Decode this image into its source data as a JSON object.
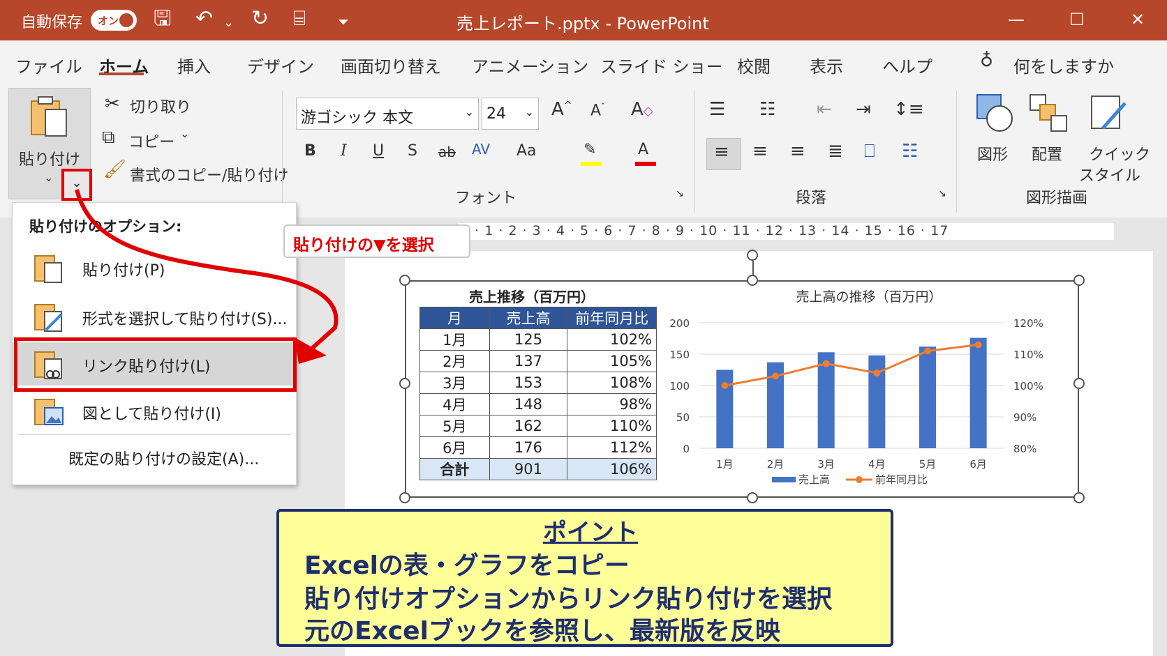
{
  "titlebar": {
    "autosave_label": "自動保存",
    "toggle_label": "オン",
    "title": "売上レポート.pptx  -  PowerPoint",
    "minimize": "—",
    "maximize": "☐",
    "close": "✕"
  },
  "tabs": [
    "ファイル",
    "ホーム",
    "挿入",
    "デザイン",
    "画面切り替え",
    "アニメーション",
    "スライド ショー",
    "校閲",
    "表示",
    "ヘルプ"
  ],
  "active_tab": "ホーム",
  "tell_me": "何をしますか",
  "ribbon": {
    "paste_label": "貼り付け",
    "cut_label": "切り取り",
    "copy_label": "コピー",
    "format_painter_label": "書式のコピー/貼り付け",
    "font_name": "游ゴシック 本文",
    "font_size": "24",
    "font_group_label": "フォント",
    "paragraph_group_label": "段落",
    "drawing_group_label": "図形描画",
    "shapes_label": "図形",
    "arrange_label": "配置",
    "quick_style_label_1": "クイック",
    "quick_style_label_2": "スタイル"
  },
  "ruler_text": "3 · 1 · 2 · 3 · 4 · 5 · 6 · 7 · 8 · 9 · 10 · 11 · 12 · 13 · 14 · 15 · 16 · 17",
  "paste_options": {
    "header": "貼り付けのオプション:",
    "items": [
      {
        "label": "貼り付け(P)"
      },
      {
        "label": "形式を選択して貼り付け(S)..."
      },
      {
        "label": "リンク貼り付け(L)"
      },
      {
        "label": "図として貼り付け(I)"
      }
    ],
    "default_settings": "既定の貼り付けの設定(A)..."
  },
  "annotation_label": "貼り付けの▼を選択",
  "table": {
    "title": "売上推移（百万円）",
    "headers": [
      "月",
      "売上高",
      "前年同月比"
    ],
    "rows": [
      [
        "1月",
        "125",
        "102%"
      ],
      [
        "2月",
        "137",
        "105%"
      ],
      [
        "3月",
        "153",
        "108%"
      ],
      [
        "4月",
        "148",
        "98%"
      ],
      [
        "5月",
        "162",
        "110%"
      ],
      [
        "6月",
        "176",
        "112%"
      ]
    ],
    "total": [
      "合計",
      "901",
      "106%"
    ]
  },
  "chart_data": {
    "type": "bar",
    "title": "売上高の推移（百万円）",
    "categories": [
      "1月",
      "2月",
      "3月",
      "4月",
      "5月",
      "6月"
    ],
    "series": [
      {
        "name": "売上高",
        "type": "bar",
        "axis": "left",
        "values": [
          125,
          137,
          153,
          148,
          162,
          176
        ],
        "color": "#4472c4"
      },
      {
        "name": "前年同月比",
        "type": "line",
        "axis": "right",
        "values": [
          100,
          103,
          107,
          104,
          111,
          113
        ],
        "color": "#ed7d31"
      }
    ],
    "ylim": [
      0,
      200
    ],
    "y_ticks": [
      "0",
      "50",
      "100",
      "150",
      "200"
    ],
    "y2lim": [
      80,
      120
    ],
    "y2_ticks": [
      "80%",
      "90%",
      "100%",
      "110%",
      "120%"
    ],
    "legend_position": "bottom"
  },
  "callout": {
    "heading": "ポイント",
    "lines": [
      "Excelの表・グラフをコピー",
      "貼り付けオプションからリンク貼り付けを選択",
      "元のExcelブックを参照し、最新版を反映"
    ]
  },
  "colors": {
    "accent": "#b7472a",
    "highlight": "#e00000",
    "callout_bg": "#ffff99",
    "callout_border": "#1f2f6e"
  }
}
